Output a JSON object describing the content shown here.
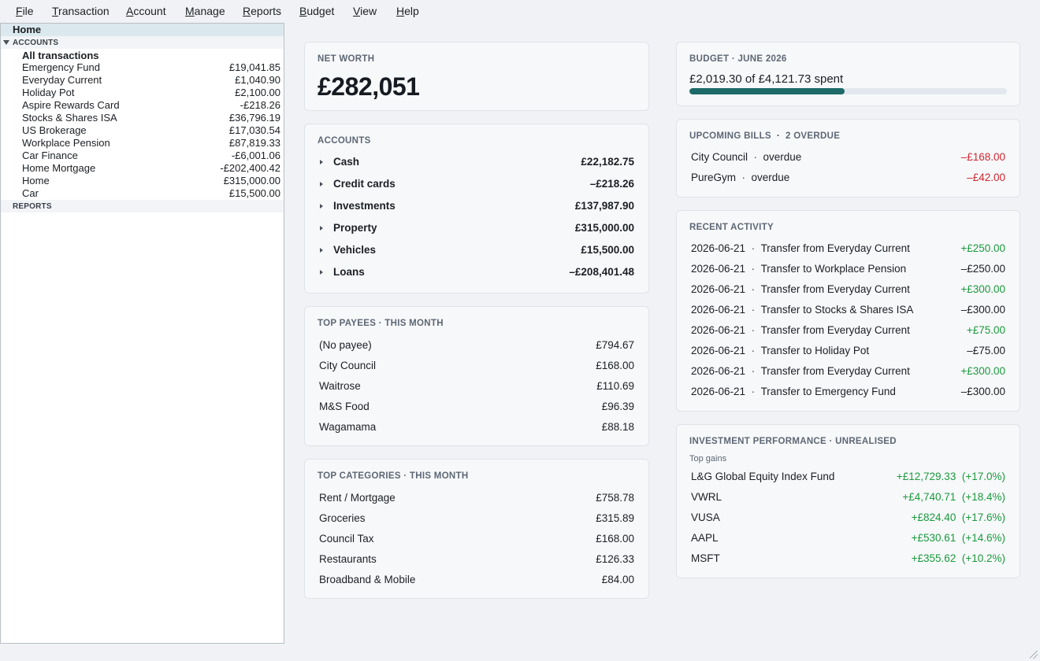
{
  "menu": [
    "File",
    "Transaction",
    "Account",
    "Manage",
    "Reports",
    "Budget",
    "View",
    "Help"
  ],
  "sidebar": {
    "home": "Home",
    "accounts_header": "ACCOUNTS",
    "all_transactions": "All transactions",
    "accounts": [
      {
        "name": "Emergency Fund",
        "balance": "£19,041.85"
      },
      {
        "name": "Everyday Current",
        "balance": "£1,040.90"
      },
      {
        "name": "Holiday Pot",
        "balance": "£2,100.00"
      },
      {
        "name": "Aspire Rewards Card",
        "balance": "-£218.26"
      },
      {
        "name": "Stocks & Shares ISA",
        "balance": "£36,796.19"
      },
      {
        "name": "US Brokerage",
        "balance": "£17,030.54"
      },
      {
        "name": "Workplace Pension",
        "balance": "£87,819.33"
      },
      {
        "name": "Car Finance",
        "balance": "-£6,001.06"
      },
      {
        "name": "Home Mortgage",
        "balance": "-£202,400.42"
      },
      {
        "name": "Home",
        "balance": "£315,000.00"
      },
      {
        "name": "Car",
        "balance": "£15,500.00"
      }
    ],
    "reports_header": "REPORTS"
  },
  "net_worth": {
    "title": "NET WORTH",
    "value": "£282,051"
  },
  "accounts_card": {
    "title": "ACCOUNTS",
    "groups": [
      {
        "name": "Cash",
        "value": "£22,182.75"
      },
      {
        "name": "Credit cards",
        "value": "–£218.26"
      },
      {
        "name": "Investments",
        "value": "£137,987.90"
      },
      {
        "name": "Property",
        "value": "£315,000.00"
      },
      {
        "name": "Vehicles",
        "value": "£15,500.00"
      },
      {
        "name": "Loans",
        "value": "–£208,401.48"
      }
    ]
  },
  "top_payees": {
    "title": "TOP PAYEES · THIS MONTH",
    "items": [
      {
        "name": "(No payee)",
        "value": "£794.67"
      },
      {
        "name": "City Council",
        "value": "£168.00"
      },
      {
        "name": "Waitrose",
        "value": "£110.69"
      },
      {
        "name": "M&S Food",
        "value": "£96.39"
      },
      {
        "name": "Wagamama",
        "value": "£88.18"
      }
    ]
  },
  "top_categories": {
    "title": "TOP CATEGORIES · THIS MONTH",
    "items": [
      {
        "name": "Rent / Mortgage",
        "value": "£758.78"
      },
      {
        "name": "Groceries",
        "value": "£315.89"
      },
      {
        "name": "Council Tax",
        "value": "£168.00"
      },
      {
        "name": "Restaurants",
        "value": "£126.33"
      },
      {
        "name": "Broadband & Mobile",
        "value": "£84.00"
      }
    ]
  },
  "budget": {
    "title": "BUDGET · JUNE 2026",
    "summary": "£2,019.30 of £4,121.73 spent",
    "progress_fraction": 0.49
  },
  "upcoming_bills": {
    "title": "UPCOMING BILLS",
    "overdue_label": "2 OVERDUE",
    "items": [
      {
        "payee": "City Council",
        "status": "overdue",
        "amount": "–£168.00"
      },
      {
        "payee": "PureGym",
        "status": "overdue",
        "amount": "–£42.00"
      }
    ]
  },
  "recent_activity": {
    "title": "RECENT ACTIVITY",
    "items": [
      {
        "date": "2026-06-21",
        "desc": "Transfer from Everyday Current",
        "amount": "+£250.00",
        "positive": true
      },
      {
        "date": "2026-06-21",
        "desc": "Transfer to Workplace Pension",
        "amount": "–£250.00",
        "positive": false
      },
      {
        "date": "2026-06-21",
        "desc": "Transfer from Everyday Current",
        "amount": "+£300.00",
        "positive": true
      },
      {
        "date": "2026-06-21",
        "desc": "Transfer to Stocks & Shares ISA",
        "amount": "–£300.00",
        "positive": false
      },
      {
        "date": "2026-06-21",
        "desc": "Transfer from Everyday Current",
        "amount": "+£75.00",
        "positive": true
      },
      {
        "date": "2026-06-21",
        "desc": "Transfer to Holiday Pot",
        "amount": "–£75.00",
        "positive": false
      },
      {
        "date": "2026-06-21",
        "desc": "Transfer from Everyday Current",
        "amount": "+£300.00",
        "positive": true
      },
      {
        "date": "2026-06-21",
        "desc": "Transfer to Emergency Fund",
        "amount": "–£300.00",
        "positive": false
      }
    ]
  },
  "investment_performance": {
    "title": "INVESTMENT PERFORMANCE · UNREALISED",
    "subhead": "Top gains",
    "items": [
      {
        "name": "L&G Global Equity Index Fund",
        "gain": "+£12,729.33",
        "pct": "(+17.0%)"
      },
      {
        "name": "VWRL",
        "gain": "+£4,740.71",
        "pct": "(+18.4%)"
      },
      {
        "name": "VUSA",
        "gain": "+£824.40",
        "pct": "(+17.6%)"
      },
      {
        "name": "AAPL",
        "gain": "+£530.61",
        "pct": "(+14.6%)"
      },
      {
        "name": "MSFT",
        "gain": "+£355.62",
        "pct": "(+10.2%)"
      }
    ]
  },
  "colors": {
    "positive": "#1a9a3d",
    "negative": "#d1262e",
    "budget_fill": "#1d6a69",
    "sidebar_selected": "#dbe9ee"
  }
}
